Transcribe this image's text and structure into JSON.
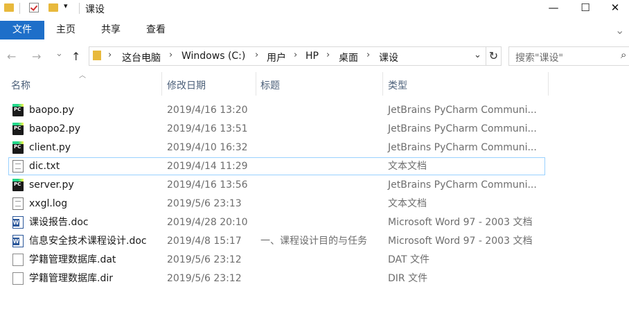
{
  "window": {
    "title": "课设",
    "minimize_glyph": "—",
    "maximize_glyph": "☐",
    "close_glyph": "✕"
  },
  "ribbon": {
    "tabs": [
      "文件",
      "主页",
      "共享",
      "查看"
    ],
    "expand_glyph": "⌄"
  },
  "nav": {
    "back_glyph": "←",
    "forward_glyph": "→",
    "recent_glyph": "⌄",
    "up_glyph": "↑",
    "refresh_glyph": "↻"
  },
  "breadcrumb": [
    "这台电脑",
    "Windows (C:)",
    "用户",
    "HP",
    "桌面",
    "课设"
  ],
  "search": {
    "placeholder": "搜索\"课设\""
  },
  "columns": {
    "name": "名称",
    "date": "修改日期",
    "title": "标题",
    "type": "类型"
  },
  "files": [
    {
      "name": "baopo.py",
      "date": "2019/4/16 13:20",
      "title": "",
      "type": "JetBrains PyCharm Communi...",
      "icon": "pycharm-icon"
    },
    {
      "name": "baopo2.py",
      "date": "2019/4/16 13:51",
      "title": "",
      "type": "JetBrains PyCharm Communi...",
      "icon": "pycharm-icon"
    },
    {
      "name": "client.py",
      "date": "2019/4/10 16:32",
      "title": "",
      "type": "JetBrains PyCharm Communi...",
      "icon": "pycharm-icon"
    },
    {
      "name": "dic.txt",
      "date": "2019/4/14 11:29",
      "title": "",
      "type": "文本文档",
      "icon": "text-file-icon",
      "selected": true
    },
    {
      "name": "server.py",
      "date": "2019/4/16 13:56",
      "title": "",
      "type": "JetBrains PyCharm Communi...",
      "icon": "pycharm-icon"
    },
    {
      "name": "xxgl.log",
      "date": "2019/5/6 23:13",
      "title": "",
      "type": "文本文档",
      "icon": "text-file-icon"
    },
    {
      "name": "课设报告.doc",
      "date": "2019/4/28 20:10",
      "title": "",
      "type": "Microsoft Word 97 - 2003 文档",
      "icon": "word-doc-icon"
    },
    {
      "name": "信息安全技术课程设计.doc",
      "date": "2019/4/8 15:17",
      "title": "一、课程设计目的与任务",
      "type": "Microsoft Word 97 - 2003 文档",
      "icon": "word-doc-icon"
    },
    {
      "name": "学籍管理数据库.dat",
      "date": "2019/5/6 23:12",
      "title": "",
      "type": "DAT 文件",
      "icon": "generic-file-icon"
    },
    {
      "name": "学籍管理数据库.dir",
      "date": "2019/5/6 23:12",
      "title": "",
      "type": "DIR 文件",
      "icon": "generic-file-icon"
    }
  ],
  "colors": {
    "file_tab": "#1e6fc9",
    "selection_border": "#99d1ff",
    "header_text": "#4c607a"
  }
}
